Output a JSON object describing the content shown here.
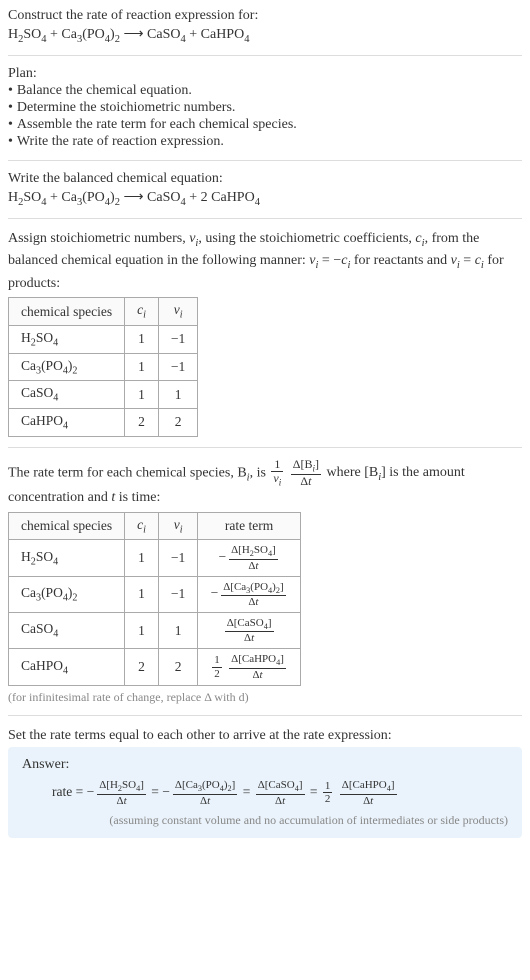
{
  "header": {
    "prompt": "Construct the rate of reaction expression for:",
    "equation_html": "H<sub>2</sub>SO<sub>4</sub> + Ca<sub>3</sub>(PO<sub>4</sub>)<sub>2</sub> ⟶ CaSO<sub>4</sub> + CaHPO<sub>4</sub>"
  },
  "plan": {
    "title": "Plan:",
    "items": [
      "Balance the chemical equation.",
      "Determine the stoichiometric numbers.",
      "Assemble the rate term for each chemical species.",
      "Write the rate of reaction expression."
    ]
  },
  "balanced": {
    "title": "Write the balanced chemical equation:",
    "equation_html": "H<sub>2</sub>SO<sub>4</sub> + Ca<sub>3</sub>(PO<sub>4</sub>)<sub>2</sub> ⟶ CaSO<sub>4</sub> + 2 CaHPO<sub>4</sub>"
  },
  "stoich": {
    "intro_html": "Assign stoichiometric numbers, <span class=\"ital\">ν<sub>i</sub></span>, using the stoichiometric coefficients, <span class=\"ital\">c<sub>i</sub></span>, from the balanced chemical equation in the following manner: <span class=\"ital\">ν<sub>i</sub></span> = −<span class=\"ital\">c<sub>i</sub></span> for reactants and <span class=\"ital\">ν<sub>i</sub></span> = <span class=\"ital\">c<sub>i</sub></span> for products:",
    "headers": {
      "species": "chemical species",
      "ci": "c<sub>i</sub>",
      "nui": "ν<sub>i</sub>"
    },
    "rows": [
      {
        "species_html": "H<sub>2</sub>SO<sub>4</sub>",
        "ci": "1",
        "nui": "−1"
      },
      {
        "species_html": "Ca<sub>3</sub>(PO<sub>4</sub>)<sub>2</sub>",
        "ci": "1",
        "nui": "−1"
      },
      {
        "species_html": "CaSO<sub>4</sub>",
        "ci": "1",
        "nui": "1"
      },
      {
        "species_html": "CaHPO<sub>4</sub>",
        "ci": "2",
        "nui": "2"
      }
    ]
  },
  "rateterm": {
    "intro_pre": "The rate term for each chemical species, B",
    "intro_mid": ", is ",
    "intro_post_html": " where [B<sub><span class=\"ital\">i</span></sub>] is the amount concentration and <span class=\"ital\">t</span> is time:",
    "headers": {
      "species": "chemical species",
      "ci": "c<sub>i</sub>",
      "nui": "ν<sub>i</sub>",
      "rate": "rate term"
    },
    "rows": [
      {
        "species_html": "H<sub>2</sub>SO<sub>4</sub>",
        "ci": "1",
        "nui": "−1",
        "rate_html": "<span class=\"neg\">−</span><span class=\"frac small-frac\"><span class=\"num\">Δ[H<sub>2</sub>SO<sub>4</sub>]</span><span class=\"den\">Δ<span class=\"ital\">t</span></span></span>"
      },
      {
        "species_html": "Ca<sub>3</sub>(PO<sub>4</sub>)<sub>2</sub>",
        "ci": "1",
        "nui": "−1",
        "rate_html": "<span class=\"neg\">−</span><span class=\"frac small-frac\"><span class=\"num\">Δ[Ca<sub>3</sub>(PO<sub>4</sub>)<sub>2</sub>]</span><span class=\"den\">Δ<span class=\"ital\">t</span></span></span>"
      },
      {
        "species_html": "CaSO<sub>4</sub>",
        "ci": "1",
        "nui": "1",
        "rate_html": "<span class=\"frac small-frac\"><span class=\"num\">Δ[CaSO<sub>4</sub>]</span><span class=\"den\">Δ<span class=\"ital\">t</span></span></span>"
      },
      {
        "species_html": "CaHPO<sub>4</sub>",
        "ci": "2",
        "nui": "2",
        "rate_html": "<span class=\"frac small-frac\"><span class=\"num\">1</span><span class=\"den\">2</span></span> <span class=\"frac small-frac\"><span class=\"num\">Δ[CaHPO<sub>4</sub>]</span><span class=\"den\">Δ<span class=\"ital\">t</span></span></span>"
      }
    ],
    "note": "(for infinitesimal rate of change, replace Δ with d)"
  },
  "final": {
    "title": "Set the rate terms equal to each other to arrive at the rate expression:",
    "answer_label": "Answer:",
    "rate_expr_html": "rate = <span class=\"neg\">−</span><span class=\"frac small-frac\"><span class=\"num\">Δ[H<sub>2</sub>SO<sub>4</sub>]</span><span class=\"den\">Δ<span class=\"ital\">t</span></span></span> = <span class=\"neg\">−</span><span class=\"frac small-frac\"><span class=\"num\">Δ[Ca<sub>3</sub>(PO<sub>4</sub>)<sub>2</sub>]</span><span class=\"den\">Δ<span class=\"ital\">t</span></span></span> = <span class=\"frac small-frac\"><span class=\"num\">Δ[CaSO<sub>4</sub>]</span><span class=\"den\">Δ<span class=\"ital\">t</span></span></span> = <span class=\"frac small-frac\"><span class=\"num\">1</span><span class=\"den\">2</span></span> <span class=\"frac small-frac\"><span class=\"num\">Δ[CaHPO<sub>4</sub>]</span><span class=\"den\">Δ<span class=\"ital\">t</span></span></span>",
    "assumption": "(assuming constant volume and no accumulation of intermediates or side products)"
  }
}
